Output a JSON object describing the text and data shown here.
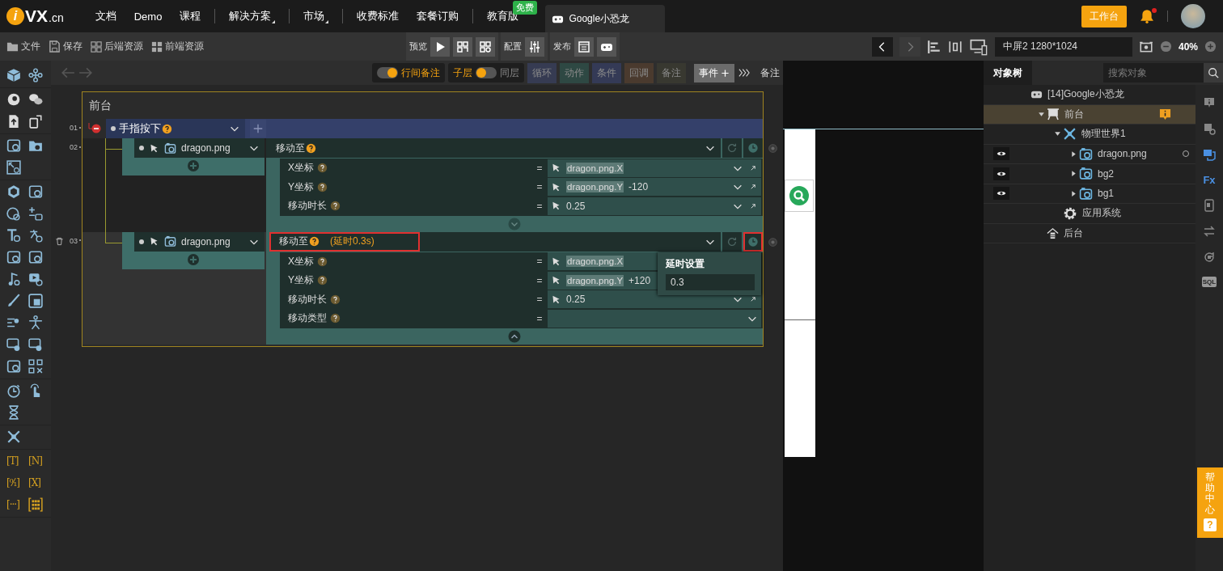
{
  "nav": {
    "logo": {
      "badge": "i",
      "name": "VX",
      "suffix": ".cn"
    },
    "groups": [
      [
        {
          "label": "文档",
          "dropdown": false
        },
        {
          "label": "Demo",
          "dropdown": false
        },
        {
          "label": "课程",
          "dropdown": false
        }
      ],
      [
        {
          "label": "解决方案",
          "dropdown": true
        }
      ],
      [
        {
          "label": "市场",
          "dropdown": true
        }
      ],
      [
        {
          "label": "收费标准",
          "dropdown": false
        },
        {
          "label": "套餐订购",
          "dropdown": false
        }
      ],
      [
        {
          "label": "教育版",
          "dropdown": false,
          "badge": "免费"
        }
      ]
    ],
    "project_tab": {
      "label": "Google小恐龙"
    },
    "workbench": "工作台",
    "notifications": {
      "unread": true
    }
  },
  "toolbar": {
    "menu": [
      "文件",
      "保存",
      "后端资源",
      "前端资源"
    ],
    "groups": [
      {
        "label": "预览"
      },
      {
        "label": "配置"
      },
      {
        "label": "发布"
      }
    ],
    "screen": "中屏2 1280*1024",
    "zoom": "40%"
  },
  "palette": {
    "variables": [
      "[T]",
      "[N]",
      "[⁰⁄₁]",
      "[X]",
      "[···]"
    ]
  },
  "editor": {
    "toolbar": {
      "inline_notes": {
        "label": "行间备注",
        "on": true
      },
      "layer": [
        {
          "label": "子层",
          "selected": true
        },
        {
          "label": "同层",
          "selected": false
        }
      ],
      "blocks": [
        {
          "label": "循环",
          "disabled": true,
          "color": "#363b52"
        },
        {
          "label": "动作",
          "disabled": true,
          "color": "#2e4843"
        },
        {
          "label": "条件",
          "disabled": true,
          "color": "#343a56"
        },
        {
          "label": "回调",
          "disabled": true,
          "color": "#4a3a2e"
        },
        {
          "label": "备注",
          "disabled": true,
          "color": "#383830"
        }
      ],
      "add_event": "事件",
      "notes": "备注"
    },
    "panel": {
      "title": "前台",
      "rows": [
        {
          "number": "01",
          "kind": "trigger",
          "label": "手指按下"
        },
        {
          "number": "02",
          "kind": "action",
          "target": "dragon.png",
          "action": "移动至",
          "highlighted": false,
          "delay_highlighted": false,
          "hovered": false,
          "show_all": false,
          "params": [
            {
              "label": "X坐标",
              "operator": "=",
              "ref": "dragon.png.X",
              "kind": "full"
            },
            {
              "label": "Y坐标",
              "operator": "=",
              "ref": "dragon.png.Y",
              "suffix": "-120",
              "kind": "full"
            },
            {
              "label": "移动时长",
              "operator": "=",
              "value": "0.25",
              "kind": "full"
            }
          ]
        },
        {
          "number": "03",
          "kind": "action",
          "target": "dragon.png",
          "action": "移动至",
          "delay": "(延时0.3s)",
          "highlighted": true,
          "delay_highlighted": true,
          "hovered": true,
          "show_all": true,
          "params": [
            {
              "label": "X坐标",
              "operator": "=",
              "ref": "dragon.png.X",
              "kind": "covered"
            },
            {
              "label": "Y坐标",
              "operator": "=",
              "ref": "dragon.png.Y",
              "suffix": "+120",
              "kind": "covered"
            },
            {
              "label": "移动时长",
              "operator": "=",
              "value": "0.25",
              "kind": "full"
            },
            {
              "label": "移动类型",
              "operator": "=",
              "kind": "select"
            }
          ],
          "popover": {
            "title": "延时设置",
            "value": "0.3"
          }
        }
      ]
    }
  },
  "object_tree": {
    "tab": "对象树",
    "search_placeholder": "搜索对象",
    "nodes": [
      {
        "label": "[14]Google小恐龙",
        "kind": "app",
        "children": [
          {
            "label": "前台",
            "kind": "stage",
            "expanded": true,
            "selected": true,
            "alert": true,
            "children": [
              {
                "label": "物理世界1",
                "kind": "physics",
                "expanded": true,
                "selected": false,
                "children": [
                  {
                    "label": "dragon.png",
                    "kind": "image",
                    "expanded": false,
                    "selected": false,
                    "visible": true,
                    "status": true
                  },
                  {
                    "label": "bg2",
                    "kind": "image",
                    "expanded": false,
                    "selected": false,
                    "visible": true,
                    "status": false
                  },
                  {
                    "label": "bg1",
                    "kind": "image",
                    "expanded": false,
                    "selected": false,
                    "visible": true,
                    "status": false
                  }
                ]
              },
              {
                "label": "应用系统",
                "kind": "system",
                "selected": false
              }
            ]
          },
          {
            "label": "后台",
            "kind": "backend",
            "selected": false
          }
        ]
      }
    ],
    "rail": [
      {
        "kind": "info",
        "active": false
      },
      {
        "kind": "info-gear",
        "active": false
      },
      {
        "kind": "info-chat",
        "active": true
      },
      {
        "kind": "text",
        "label": "Fx",
        "active": true
      },
      {
        "kind": "phone",
        "active": false
      },
      {
        "kind": "swap",
        "active": false
      },
      {
        "kind": "refresh",
        "active": false
      },
      {
        "kind": "text",
        "label": "SQL",
        "active": false
      }
    ]
  },
  "help": {
    "label": "帮助中心",
    "icon": "?"
  }
}
